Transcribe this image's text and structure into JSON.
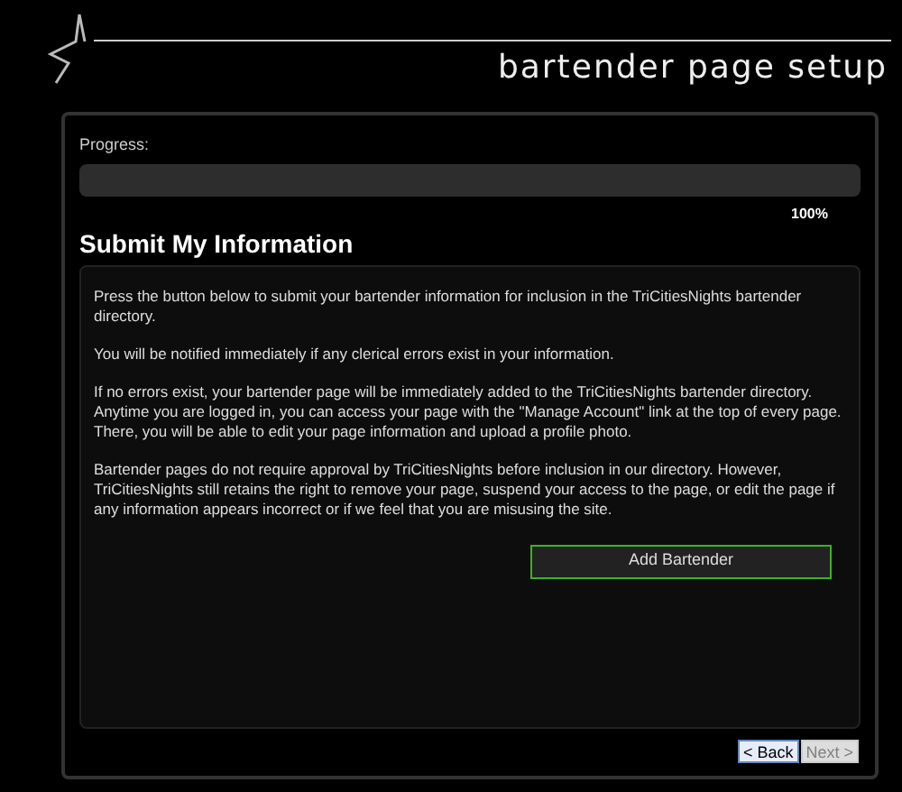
{
  "header": {
    "title": "bartender page setup"
  },
  "progress": {
    "label": "Progress:",
    "level": 1,
    "reading": "100%"
  },
  "heading": "Submit My Information",
  "paragraphs": [
    "Press the button below to submit your bartender information for inclusion in the TriCitiesNights bartender directory.",
    "You will be notified immediately if any clerical errors exist in your information.",
    "If no errors exist, your bartender page will be immediately added to the TriCitiesNights bartender directory. Anytime you are logged in, you can access your page with the \"Manage Account\" link at the top of every page. There, you will be able to edit your page information and upload a profile photo.",
    "Bartender pages do not require approval by TriCitiesNights before inclusion in our directory. However, TriCitiesNights still retains the right to remove your page, suspend your access to the page, or edit the page if any information appears incorrect or if we feel that you are misusing the site."
  ],
  "submit_button": "Add Bartender",
  "nav_buttons": [
    {
      "label": "< Back",
      "disabled": false
    },
    {
      "label": "Next >",
      "disabled": true
    }
  ]
}
